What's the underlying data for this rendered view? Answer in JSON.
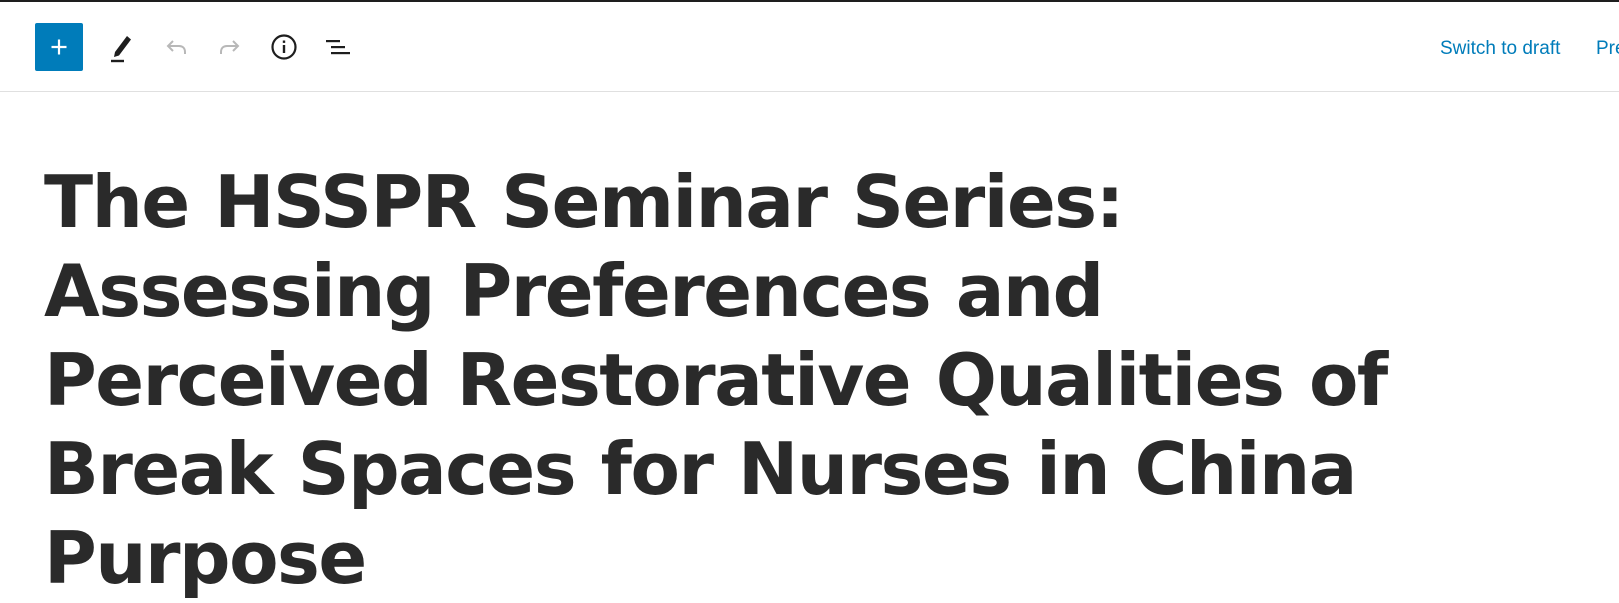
{
  "toolbar": {
    "inserter_icon": "plus-icon",
    "tools_icon": "pencil-icon",
    "undo_icon": "undo-icon",
    "redo_icon": "redo-icon",
    "details_icon": "info-icon",
    "outline_icon": "list-view-icon",
    "switch_to_draft_label": "Switch to draft",
    "preview_label": "Pre",
    "accent_color": "#007cba"
  },
  "post": {
    "title": "The HSSPR Seminar Series: Assessing Preferences and Perceived Restorative Qualities of Break Spaces for Nurses in China Purpose"
  }
}
